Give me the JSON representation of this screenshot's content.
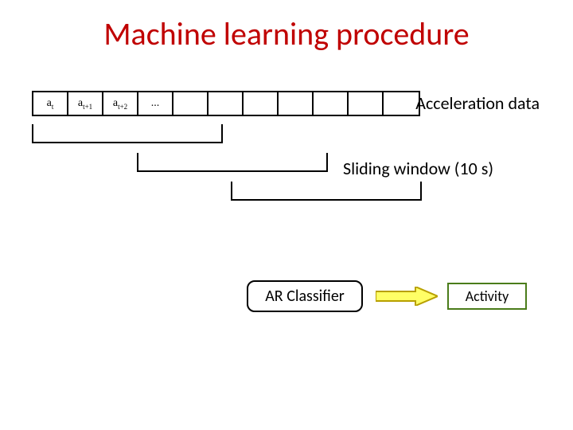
{
  "title": "Machine learning procedure",
  "cells": {
    "c0_base": "a",
    "c0_sub": "t",
    "c1_base": "a",
    "c1_sub": "t+1",
    "c2_base": "a",
    "c2_sub": "t+2",
    "c3": "..."
  },
  "labels": {
    "acceleration": "Acceleration data",
    "sliding_window": "Sliding window (10 s)",
    "classifier": "AR Classifier",
    "activity": "Activity"
  }
}
